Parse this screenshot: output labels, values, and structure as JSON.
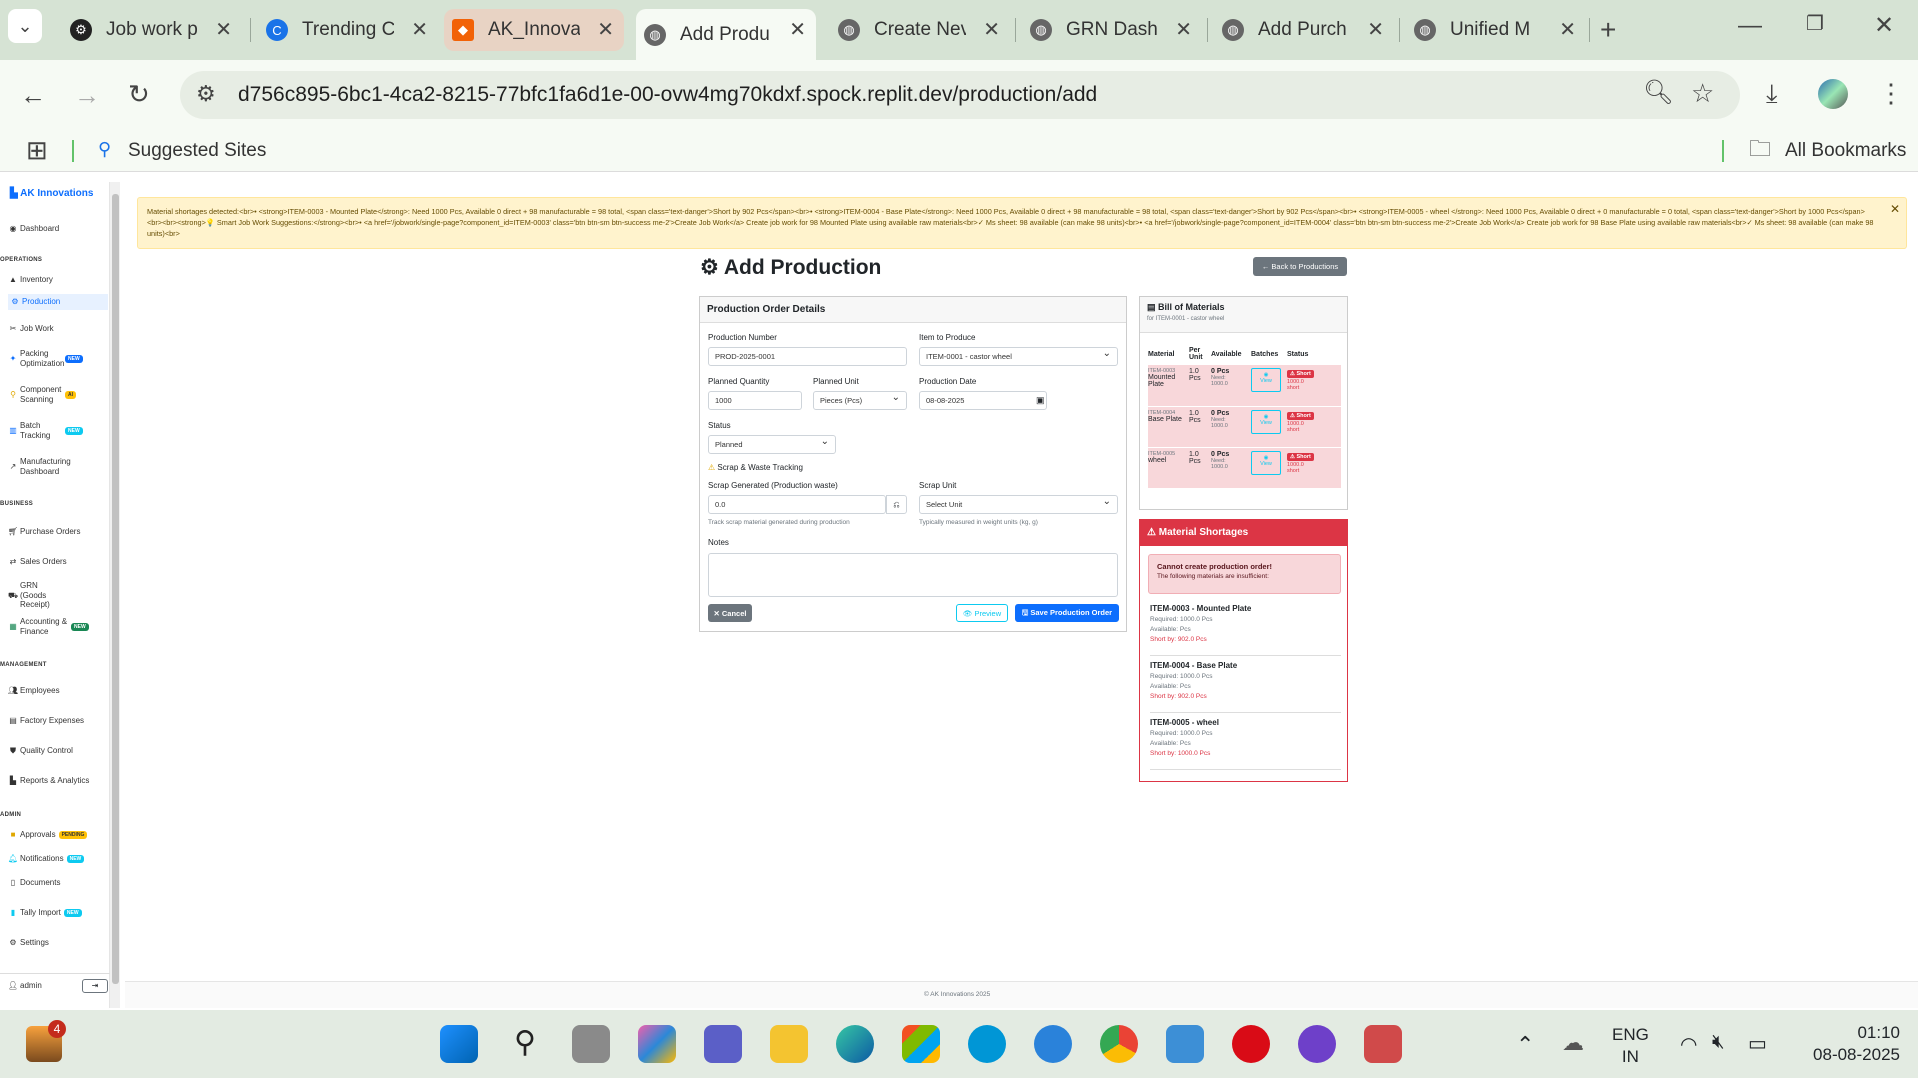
{
  "browser": {
    "tabs": [
      {
        "title": "Job work p"
      },
      {
        "title": "Trending C"
      },
      {
        "title": "AK_Innovat"
      },
      {
        "title": "Add Produ"
      },
      {
        "title": "Create Nev"
      },
      {
        "title": "GRN Dashb"
      },
      {
        "title": "Add Purch"
      },
      {
        "title": "Unified M"
      }
    ],
    "url": "d756c895-6bc1-4ca2-8215-77bfc1fa6d1e-00-ovw4mg70kdxf.spock.replit.dev/production/add",
    "bookmarks": {
      "suggested": "Suggested Sites",
      "all": "All Bookmarks"
    }
  },
  "sidebar": {
    "brand": "AK Innovations",
    "dashboard": "Dashboard",
    "sections": {
      "operations": "OPERATIONS",
      "business": "BUSINESS",
      "management": "MANAGEMENT",
      "admin": "ADMIN"
    },
    "operations": [
      "Inventory",
      "Production",
      "Job Work",
      "Packing Optimization",
      "Component Scanning",
      "Batch Tracking",
      "Manufacturing Dashboard"
    ],
    "business": [
      "Purchase Orders",
      "Sales Orders",
      "GRN (Goods Receipt)",
      "Accounting & Finance"
    ],
    "management": [
      "Employees",
      "Factory Expenses",
      "Quality Control",
      "Reports & Analytics"
    ],
    "admin": [
      "Approvals",
      "Notifications",
      "Documents",
      "Tally Import",
      "Settings"
    ],
    "badges": {
      "new": "NEW",
      "ai": "AI",
      "pending": "PENDING"
    },
    "user": "admin"
  },
  "alert": {
    "text": "Material shortages detected:<br>• <strong>ITEM-0003 - Mounted Plate</strong>: Need 1000 Pcs, Available 0 direct + 98 manufacturable = 98 total, <span class='text-danger'>Short by 902 Pcs</span><br>• <strong>ITEM-0004 - Base Plate</strong>: Need 1000 Pcs, Available 0 direct + 98 manufacturable = 98 total, <span class='text-danger'>Short by 902 Pcs</span><br>• <strong>ITEM-0005 - wheel </strong>: Need 1000 Pcs, Available 0 direct + 0 manufacturable = 0 total, <span class='text-danger'>Short by 1000 Pcs</span><br><br><strong>💡 Smart Job Work Suggestions:</strong><br>• <a href='/jobwork/single-page?component_id=ITEM-0003' class='btn btn-sm btn-success me-2'>Create Job Work</a> Create job work for 98 Mounted Plate using available raw materials<br>✓ Ms sheet: 98 available (can make 98 units)<br>• <a href='/jobwork/single-page?component_id=ITEM-0004' class='btn btn-sm btn-success me-2'>Create Job Work</a> Create job work for 98 Base Plate using available raw materials<br>✓ Ms sheet: 98 available (can make 98 units)<br>"
  },
  "page": {
    "title": "Add Production",
    "back": "← Back to Productions"
  },
  "form": {
    "header": "Production Order Details",
    "production_number_label": "Production Number",
    "production_number": "PROD-2025-0001",
    "item_label": "Item to Produce",
    "item": "ITEM-0001 - castor wheel",
    "qty_label": "Planned Quantity",
    "qty": "1000",
    "unit_label": "Planned Unit",
    "unit": "Pieces (Pcs)",
    "date_label": "Production Date",
    "date": "08-08-2025",
    "status_label": "Status",
    "status": "Planned",
    "scrap_section": "Scrap & Waste Tracking",
    "scrap_label": "Scrap Generated (Production waste)",
    "scrap": "0.0",
    "scrap_hint": "Track scrap material generated during production",
    "scrap_unit_label": "Scrap Unit",
    "scrap_unit": "Select Unit",
    "scrap_unit_hint": "Typically measured in weight units (kg, g)",
    "notes_label": "Notes",
    "cancel": "✕ Cancel",
    "preview": "👁 Preview",
    "save": "🖫 Save Production Order"
  },
  "bom": {
    "title": "Bill of Materials",
    "subtitle": "for ITEM-0001 - castor wheel",
    "columns": [
      "Material",
      "Per Unit",
      "Available",
      "Batches",
      "Status"
    ],
    "rows": [
      {
        "code": "ITEM-0003",
        "name": "Mounted Plate",
        "per": "1.0 Pcs",
        "avail": "0 Pcs",
        "need": "Need: 1000.0",
        "view": "View",
        "status": "Short",
        "short": "1000.0 short"
      },
      {
        "code": "ITEM-0004",
        "name": "Base Plate",
        "per": "1.0 Pcs",
        "avail": "0 Pcs",
        "need": "Need: 1000.0",
        "view": "View",
        "status": "Short",
        "short": "1000.0 short"
      },
      {
        "code": "ITEM-0005",
        "name": "wheel",
        "per": "1.0 Pcs",
        "avail": "0 Pcs",
        "need": "Need: 1000.0",
        "view": "View",
        "status": "Short",
        "short": "1000.0 short"
      }
    ]
  },
  "shortages": {
    "title": "Material Shortages",
    "alert_title": "Cannot create production order!",
    "alert_text": "The following materials are insufficient:",
    "items": [
      {
        "name": "ITEM-0003 - Mounted Plate",
        "req": "Required: 1000.0 Pcs",
        "avail": "Available: Pcs",
        "short": "Short by: 902.0 Pcs"
      },
      {
        "name": "ITEM-0004 - Base Plate",
        "req": "Required: 1000.0 Pcs",
        "avail": "Available: Pcs",
        "short": "Short by: 902.0 Pcs"
      },
      {
        "name": "ITEM-0005 - wheel",
        "req": "Required: 1000.0 Pcs",
        "avail": "Available: Pcs",
        "short": "Short by: 1000.0 Pcs"
      }
    ]
  },
  "footer": "© AK Innovations 2025",
  "taskbar": {
    "notif_count": "4",
    "lang1": "ENG",
    "lang2": "IN",
    "time": "01:10",
    "date": "08-08-2025"
  },
  "colors": {
    "primary": "#0d6efd",
    "danger": "#dc3545",
    "warning_bg": "#fff3cd",
    "tabbar": "#d6e3d4"
  }
}
